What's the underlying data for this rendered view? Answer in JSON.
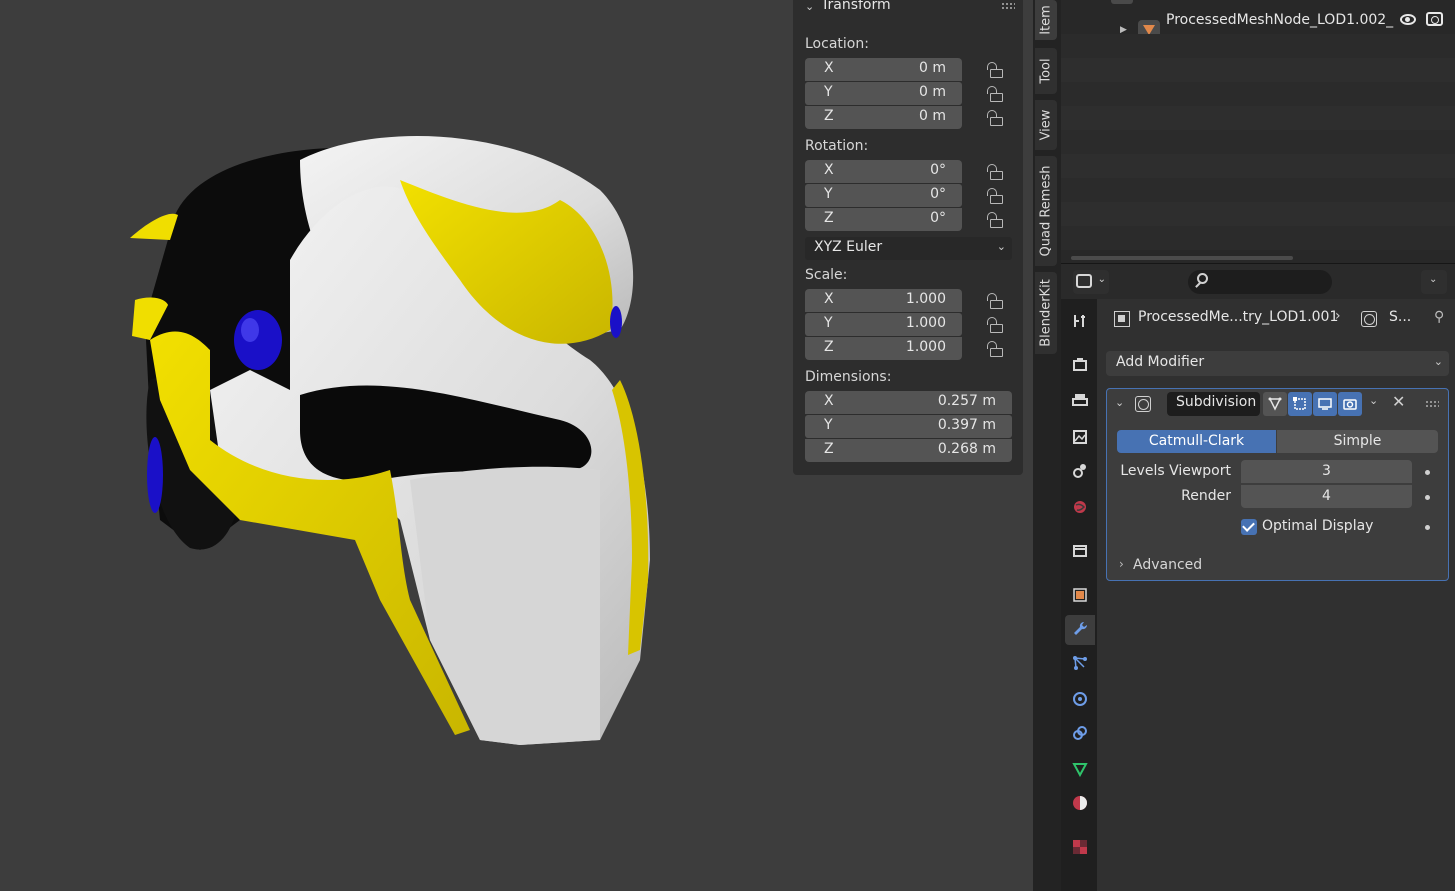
{
  "transform": {
    "title": "Transform",
    "location_label": "Location:",
    "location": [
      {
        "axis": "X",
        "value": "0 m"
      },
      {
        "axis": "Y",
        "value": "0 m"
      },
      {
        "axis": "Z",
        "value": "0 m"
      }
    ],
    "rotation_label": "Rotation:",
    "rotation": [
      {
        "axis": "X",
        "value": "0°"
      },
      {
        "axis": "Y",
        "value": "0°"
      },
      {
        "axis": "Z",
        "value": "0°"
      }
    ],
    "rotation_mode": "XYZ Euler",
    "scale_label": "Scale:",
    "scale": [
      {
        "axis": "X",
        "value": "1.000"
      },
      {
        "axis": "Y",
        "value": "1.000"
      },
      {
        "axis": "Z",
        "value": "1.000"
      }
    ],
    "dimensions_label": "Dimensions:",
    "dimensions": [
      {
        "axis": "X",
        "value": "0.257 m"
      },
      {
        "axis": "Y",
        "value": "0.397 m"
      },
      {
        "axis": "Z",
        "value": "0.268 m"
      }
    ]
  },
  "sidebar_tabs": [
    "Item",
    "Tool",
    "View",
    "Quad Remesh",
    "BlenderKit"
  ],
  "outliner": {
    "row_label": "ProcessedMeshNode_LOD1.002_"
  },
  "properties": {
    "breadcrumb_object": "ProcessedMe...try_LOD1.001",
    "breadcrumb_modifier": "S...",
    "add_modifier_label": "Add Modifier",
    "modifier": {
      "name": "Subdivision",
      "algorithm_options": [
        "Catmull-Clark",
        "Simple"
      ],
      "selected_algorithm": "Catmull-Clark",
      "levels_viewport_label": "Levels Viewport",
      "levels_viewport": "3",
      "render_label": "Render",
      "render": "4",
      "optimal_display_label": "Optimal Display",
      "optimal_display": true,
      "advanced_label": "Advanced"
    }
  },
  "colors": {
    "accent": "#4772b3",
    "helmet_yellow": "#e8d400",
    "helmet_white": "#e6e6e6",
    "helmet_black": "#0a0a0a",
    "helmet_blue": "#1a10c8"
  }
}
